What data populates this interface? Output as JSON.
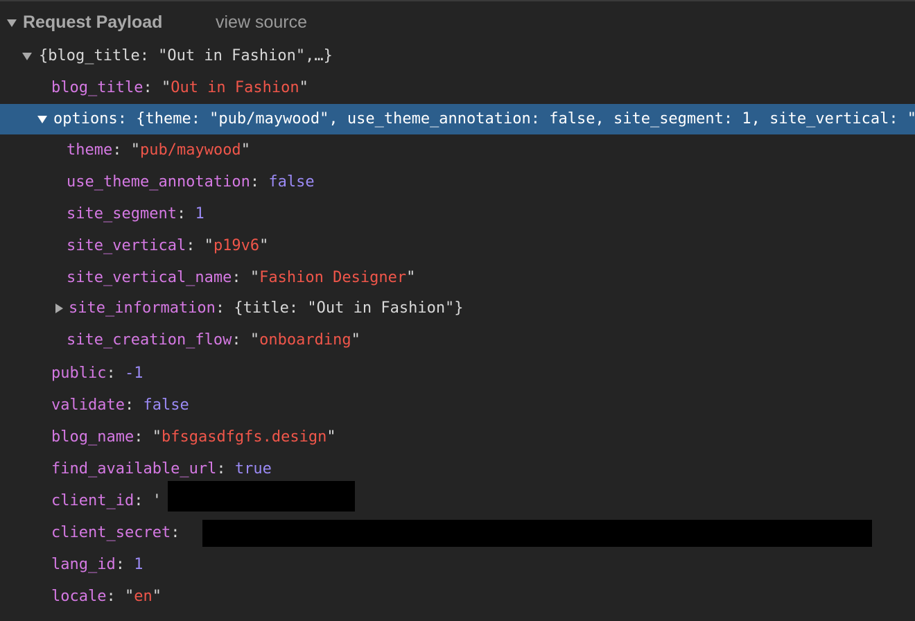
{
  "section": {
    "title": "Request Payload",
    "view_source": "view source"
  },
  "root_summary": "{blog_title: \"Out in Fashion\",…}",
  "rows": {
    "blog_title": {
      "key": "blog_title",
      "value": "Out in Fashion"
    },
    "options": {
      "key": "options",
      "summary": "{theme: \"pub/maywood\", use_theme_annotation: false, site_segment: 1, site_vertical: \"p19v6\", site_vertical_name: \"Fashion Designer\",…}",
      "children": {
        "theme": {
          "key": "theme",
          "value": "pub/maywood"
        },
        "use_theme_annotation": {
          "key": "use_theme_annotation",
          "value": "false"
        },
        "site_segment": {
          "key": "site_segment",
          "value": "1"
        },
        "site_vertical": {
          "key": "site_vertical",
          "value": "p19v6"
        },
        "site_vertical_name": {
          "key": "site_vertical_name",
          "value": "Fashion Designer"
        },
        "site_information": {
          "key": "site_information",
          "summary": "{title: \"Out in Fashion\"}"
        },
        "site_creation_flow": {
          "key": "site_creation_flow",
          "value": "onboarding"
        }
      }
    },
    "public": {
      "key": "public",
      "value": "-1"
    },
    "validate": {
      "key": "validate",
      "value": "false"
    },
    "blog_name": {
      "key": "blog_name",
      "value": "bfsgasdfgfs.design"
    },
    "find_available_url": {
      "key": "find_available_url",
      "value": "true"
    },
    "client_id": {
      "key": "client_id",
      "value_prefix": "'"
    },
    "client_secret": {
      "key": "client_secret"
    },
    "lang_id": {
      "key": "lang_id",
      "value": "1"
    },
    "locale": {
      "key": "locale",
      "value": "en"
    }
  },
  "colors": {
    "background": "#242424",
    "selection": "#2c5e8c",
    "key": "#d579e3",
    "string": "#f0564a",
    "number": "#9b8af5",
    "text": "#d8d8d8"
  }
}
